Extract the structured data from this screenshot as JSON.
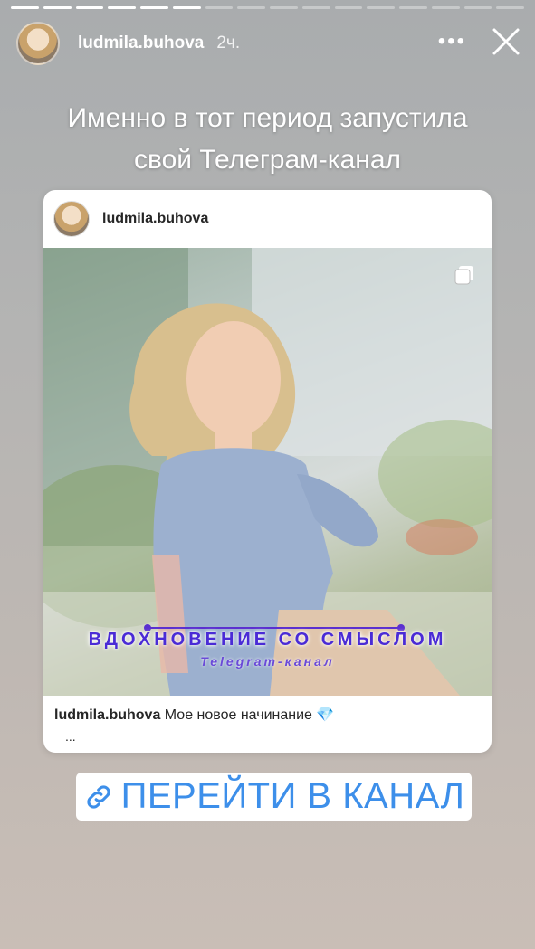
{
  "story": {
    "segments_total": 16,
    "segments_done": 6,
    "username": "ludmila.buhova",
    "time": "2ч.",
    "more_icon": "more-horizontal-icon",
    "close_icon": "close-icon",
    "caption_line1": "Именно в тот период запустила",
    "caption_line2": "свой Телеграм-канал"
  },
  "post": {
    "username": "ludmila.buhova",
    "multi_icon": "carousel-icon",
    "overlay_title": "ВДОХНОВЕНИЕ СО СМЫСЛОМ",
    "overlay_subtitle": "Telegram-канал",
    "caption_user": "ludmila.buhova",
    "caption_text": "Мое новое начинание 💎",
    "caption_more": "..."
  },
  "link": {
    "icon": "link-icon",
    "label": "ПЕРЕЙТИ В КАНАЛ",
    "color": "#3d8fea"
  }
}
